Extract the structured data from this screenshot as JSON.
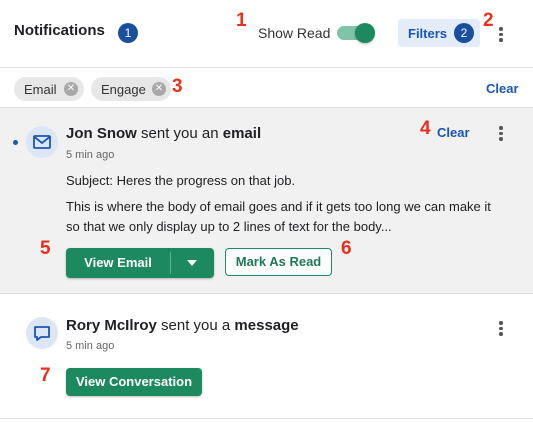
{
  "header": {
    "title": "Notifications",
    "unread_count": "1",
    "show_read_label": "Show Read",
    "show_read_on": true,
    "filters_label": "Filters",
    "filters_count": "2"
  },
  "filters": {
    "chips": [
      {
        "label": "Email"
      },
      {
        "label": "Engage"
      }
    ],
    "clear_label": "Clear"
  },
  "notifications": [
    {
      "unread": true,
      "icon": "envelope-icon",
      "sender": "Jon Snow",
      "action": "sent you an",
      "object": "email",
      "time": "5 min ago",
      "clear_label": "Clear",
      "subject": "Subject: Heres the progress on that job.",
      "body": "This is where the body of email goes and if it gets too long we can make it so that we only display up to 2 lines of text for the body...",
      "primary_action": "View Email",
      "secondary_action": "Mark As Read"
    },
    {
      "unread": false,
      "icon": "chat-bubble-icon",
      "sender": "Rory McIlroy",
      "action": "sent you a",
      "object": "message",
      "time": "5 min ago",
      "primary_action": "View Conversation"
    }
  ],
  "step_markers": [
    "1",
    "2",
    "3",
    "4",
    "5",
    "6",
    "7"
  ],
  "colors": {
    "accent_blue": "#1a56b8",
    "badge_blue": "#1a4fa0",
    "primary_green": "#1c8a5e",
    "marker_red": "#e8301c",
    "unread_background": "#f1f1f1"
  }
}
